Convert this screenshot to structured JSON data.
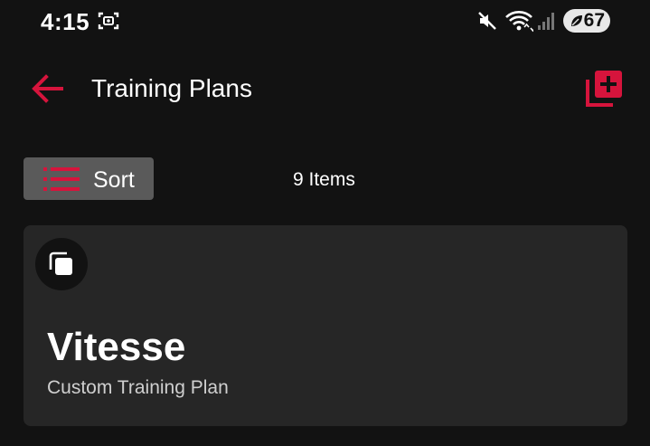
{
  "status_bar": {
    "time": "4:15",
    "battery": "67",
    "icons": [
      "screenshot-icon",
      "mute-icon",
      "wifi-icon",
      "signal-icon",
      "battery-saver-leaf-icon"
    ]
  },
  "header": {
    "title": "Training Plans",
    "back_icon": "arrow-left-icon",
    "add_icon": "add-library-icon"
  },
  "toolbar": {
    "sort_label": "Sort",
    "items_count": "9 Items"
  },
  "plans": [
    {
      "name": "Vitesse",
      "type": "Custom Training Plan",
      "icon": "copy-icon"
    }
  ],
  "colors": {
    "accent": "#d6143c",
    "background": "#121212",
    "card": "#262626",
    "sort_button": "#5a5a5a"
  }
}
